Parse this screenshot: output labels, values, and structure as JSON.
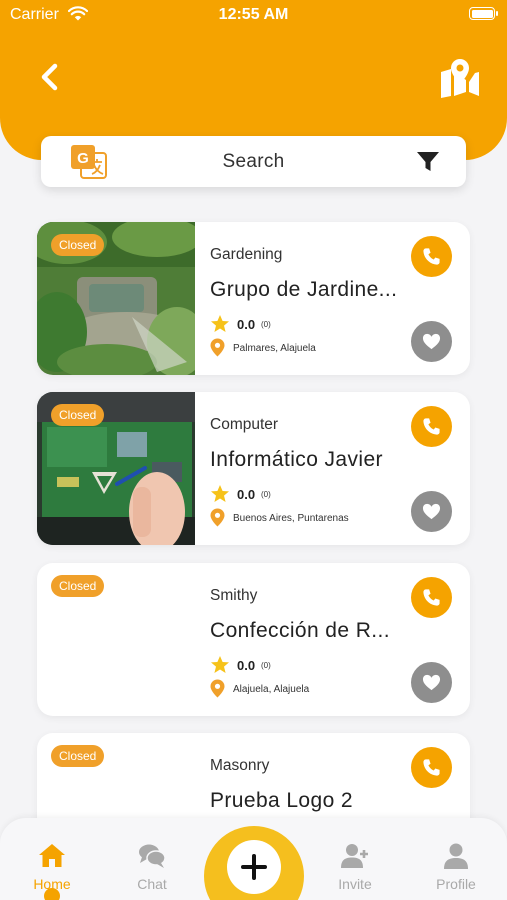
{
  "status_bar": {
    "carrier": "Carrier",
    "time": "12:55 AM"
  },
  "header": {
    "back_icon": "chevron-left-icon",
    "map_icon": "map-pin-icon"
  },
  "search": {
    "label": "Search",
    "translate_icon": "google-translate-icon",
    "filter_icon": "filter-icon"
  },
  "listings": [
    {
      "status": "Closed",
      "category": "Gardening",
      "name": "Grupo de Jardine...",
      "rating": "0.0",
      "review_count": "(0)",
      "location": "Palmares, Alajuela",
      "image": "garden-photo"
    },
    {
      "status": "Closed",
      "category": "Computer",
      "name": "Informático Javier",
      "rating": "0.0",
      "review_count": "(0)",
      "location": "Buenos Aires, Puntarenas",
      "image": "motherboard-photo"
    },
    {
      "status": "Closed",
      "category": "Smithy",
      "name": "Confección de R...",
      "rating": "0.0",
      "review_count": "(0)",
      "location": "Alajuela, Alajuela",
      "image": "none"
    },
    {
      "status": "Closed",
      "category": "Masonry",
      "name": "Prueba Logo 2",
      "rating": "",
      "review_count": "",
      "location": "",
      "image": "none"
    }
  ],
  "tabbar": {
    "home": "Home",
    "chat": "Chat",
    "invite": "Invite",
    "profile": "Profile",
    "active": "Home"
  },
  "colors": {
    "brand": "#f5a300",
    "center_button": "#f5bf1e",
    "favorite_inactive": "#8e8e8e",
    "tab_inactive": "#a9a9a9"
  }
}
